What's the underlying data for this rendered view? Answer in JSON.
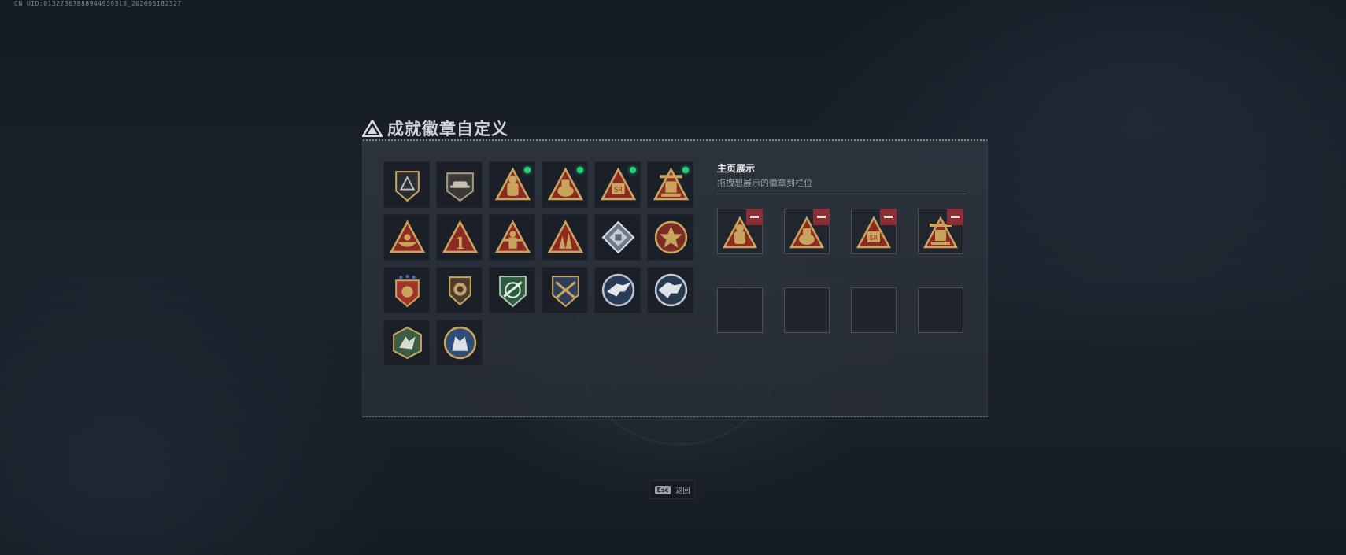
{
  "uid_text": "CN UID:013273678889449393l8_202605182327",
  "panel": {
    "title": "成就徽章自定义"
  },
  "colors": {
    "gold": "#c9a45c",
    "red": "#8e2a24",
    "new_dot": "#28d07a",
    "remove": "#8c2e35"
  },
  "badges": [
    {
      "icon": "shield-triangle-icon",
      "new": false
    },
    {
      "icon": "shield-helmet-icon",
      "new": false
    },
    {
      "icon": "triangle-knight-icon",
      "new": true
    },
    {
      "icon": "triangle-pot-icon",
      "new": true
    },
    {
      "icon": "triangle-sr-icon",
      "new": true
    },
    {
      "icon": "triangle-machine-icon",
      "new": true
    },
    {
      "icon": "triangle-bowl-icon",
      "new": false
    },
    {
      "icon": "triangle-number-one-icon",
      "new": false
    },
    {
      "icon": "triangle-figure-icon",
      "new": false
    },
    {
      "icon": "triangle-spikes-icon",
      "new": false
    },
    {
      "icon": "diamond-silver-icon",
      "new": false
    },
    {
      "icon": "medal-star-icon",
      "new": false
    },
    {
      "icon": "shield-stars-icon",
      "new": false
    },
    {
      "icon": "shield-lion-icon",
      "new": false
    },
    {
      "icon": "shield-green-rifle-icon",
      "new": false
    },
    {
      "icon": "shield-crossed-rifles-icon",
      "new": false
    },
    {
      "icon": "circle-eagle-icon",
      "new": false
    },
    {
      "icon": "circle-eagle-alt-icon",
      "new": false
    },
    {
      "icon": "hexagon-green-wolf-icon",
      "new": false
    },
    {
      "icon": "circle-wolf-icon",
      "new": false
    }
  ],
  "showcase": {
    "title": "主页展示",
    "subtitle": "拖拽想展示的徽章到栏位",
    "slots": [
      {
        "icon": "triangle-knight-icon",
        "filled": true
      },
      {
        "icon": "triangle-pot-icon",
        "filled": true
      },
      {
        "icon": "triangle-sr-icon",
        "filled": true
      },
      {
        "icon": "triangle-machine-icon",
        "filled": true
      },
      {
        "icon": "",
        "filled": false
      },
      {
        "icon": "",
        "filled": false
      },
      {
        "icon": "",
        "filled": false
      },
      {
        "icon": "",
        "filled": false
      }
    ]
  },
  "footer": {
    "esc_key": "Esc",
    "esc_label": "返回"
  }
}
